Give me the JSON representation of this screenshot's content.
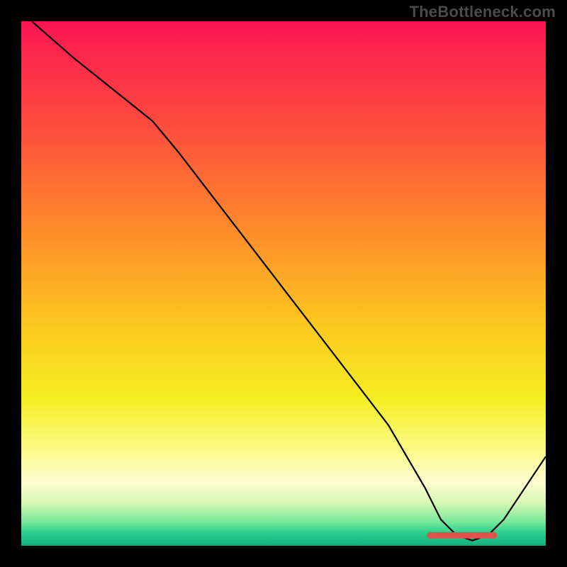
{
  "watermark": "TheBottleneck.com",
  "chart_data": {
    "type": "line",
    "title": "",
    "xlabel": "",
    "ylabel": "",
    "xlim": [
      0,
      100
    ],
    "ylim": [
      0,
      100
    ],
    "x": [
      2,
      10,
      20,
      25,
      30,
      40,
      50,
      60,
      70,
      77,
      80,
      83,
      86,
      89,
      92,
      100
    ],
    "values": [
      100,
      93,
      85,
      81,
      75,
      62,
      49,
      36,
      23,
      11,
      5,
      2,
      1,
      2,
      5,
      17
    ],
    "marker_band": {
      "x_start": 78,
      "x_end": 90,
      "y": 2,
      "color": "#e0524c"
    },
    "gradient_stops": [
      {
        "offset": 0.0,
        "color": "#fb1552"
      },
      {
        "offset": 0.2,
        "color": "#fd4c3e"
      },
      {
        "offset": 0.4,
        "color": "#fe8c2b"
      },
      {
        "offset": 0.58,
        "color": "#fbc81f"
      },
      {
        "offset": 0.72,
        "color": "#f4ee23"
      },
      {
        "offset": 0.82,
        "color": "#fbfb8c"
      },
      {
        "offset": 0.88,
        "color": "#fefcd2"
      },
      {
        "offset": 0.92,
        "color": "#d3f7b2"
      },
      {
        "offset": 0.955,
        "color": "#74e89c"
      },
      {
        "offset": 0.975,
        "color": "#2dcf8f"
      },
      {
        "offset": 1.0,
        "color": "#14b07f"
      }
    ]
  }
}
